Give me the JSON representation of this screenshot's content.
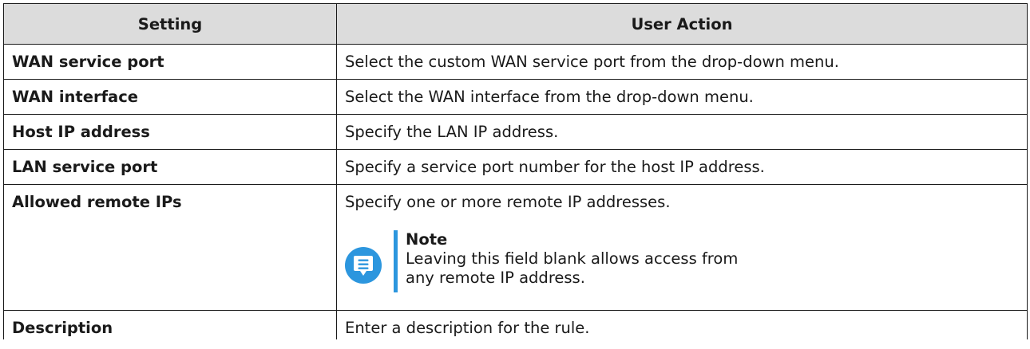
{
  "table": {
    "headers": [
      "Setting",
      "User Action"
    ],
    "rows": [
      {
        "setting": "WAN service port",
        "action": "Select the custom WAN service port from the drop-down menu."
      },
      {
        "setting": "WAN interface",
        "action": "Select the WAN interface from the drop-down menu."
      },
      {
        "setting": "Host IP address",
        "action": "Specify the LAN IP address."
      },
      {
        "setting": "LAN service port",
        "action": "Specify a service port number for the host IP address."
      },
      {
        "setting": "Allowed remote IPs",
        "action": "Specify one or more remote IP addresses."
      },
      {
        "setting": "Description",
        "action": "Enter a description for the rule."
      }
    ]
  },
  "note": {
    "icon": "note-icon",
    "title": "Note",
    "text": "Leaving this field blank allows access from any remote IP address."
  },
  "colors": {
    "header_bg": "#dcdcdc",
    "accent": "#2c96de",
    "border": "#1a1a1a"
  }
}
